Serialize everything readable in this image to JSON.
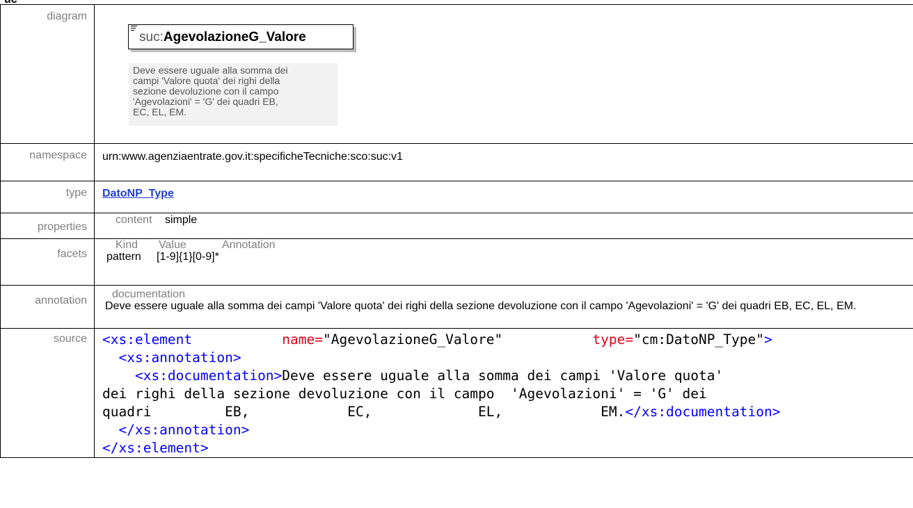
{
  "header_fragment": "uc",
  "rows": {
    "diagram": {
      "label": "diagram",
      "element_prefix": "suc:",
      "element_name": "AgevolazioneG_Valore",
      "doc_lines": [
        "Deve essere uguale alla somma dei",
        "campi 'Valore quota' dei righi della",
        "sezione devoluzione con il campo",
        "'Agevolazioni' = 'G' dei quadri EB,",
        "EC, EL, EM."
      ]
    },
    "namespace": {
      "label": "namespace",
      "value": "urn:www.agenziaentrate.gov.it:specificheTecniche:sco:suc:v1"
    },
    "type": {
      "label": "type",
      "value": "DatoNP_Type"
    },
    "properties": {
      "label": "properties",
      "key": "content",
      "value": "simple"
    },
    "facets": {
      "label": "facets",
      "headers": [
        "Kind",
        "Value",
        "Annotation"
      ],
      "kind": "pattern",
      "value": "[1-9]{1}[0-9]*"
    },
    "annotation": {
      "label": "annotation",
      "heading": "documentation",
      "text": "Deve essere uguale alla somma dei campi 'Valore quota' dei righi della sezione devoluzione con il campo 'Agevolazioni' = 'G' dei quadri EB, EC, EL, EM."
    },
    "source": {
      "label": "source",
      "open_tag": "<xs:element",
      "name_attr": "name=",
      "name_val": "\"AgevolazioneG_Valore\"",
      "type_attr": "type=",
      "type_val": "\"cm:DatoNP_Type\"",
      "gt": ">",
      "ann_open": "<xs:annotation>",
      "doc_open": "<xs:documentation>",
      "doc_line1": "Deve essere uguale alla somma dei campi 'Valore quota'",
      "doc_line2": "dei righi della sezione devoluzione con il campo  'Agevolazioni' = 'G' dei",
      "doc_line3": "quadri         EB,            EC,             EL,            EM.",
      "doc_close": "</xs:documentation>",
      "ann_close": "</xs:annotation>",
      "elem_close": "</xs:element>"
    }
  }
}
